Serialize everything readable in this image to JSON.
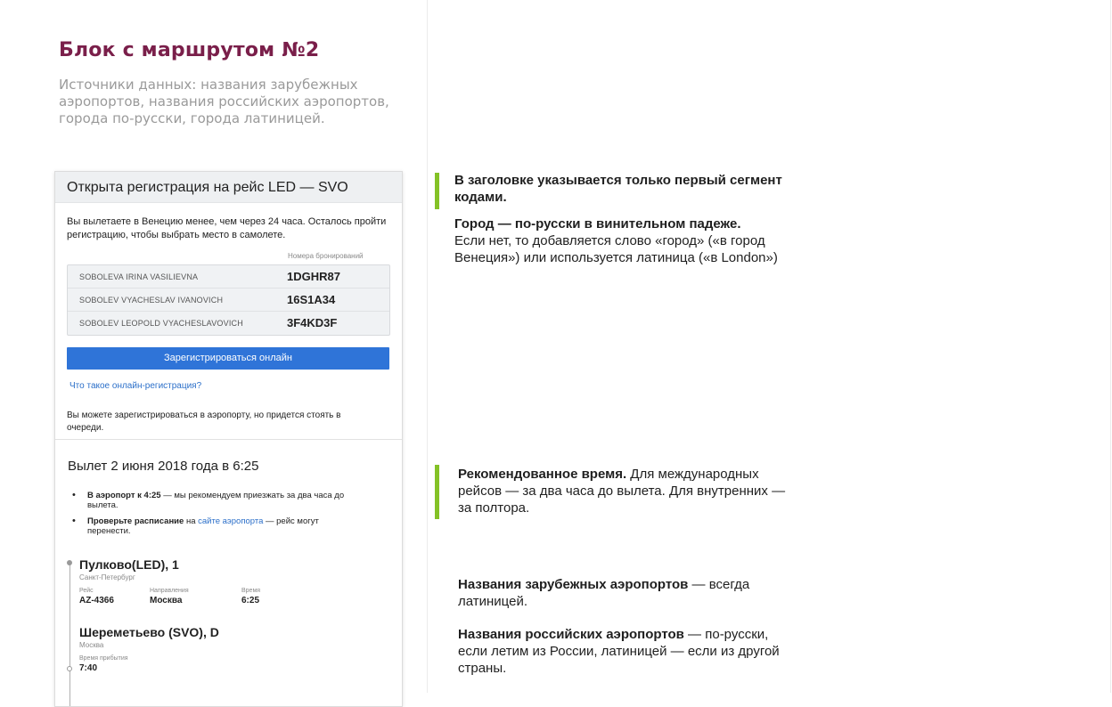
{
  "heading": {
    "title": "Блок с маршрутом №2",
    "subtitle": "Источники данных: названия зарубежных аэропортов, названия российских аэропортов, города по-русски, города латиницей."
  },
  "card": {
    "header": "Открыта регистрация на рейс LED — SVO",
    "intro": "Вы вылетаете в Венецию менее, чем через 24 часа. Осталось пройти регистрацию, чтобы выбрать место в самолете.",
    "pnr_caption": "Номера бронирований",
    "passengers": [
      {
        "name": "SOBOLEVA IRINA VASILIEVNA",
        "code": "1DGHR87"
      },
      {
        "name": "SOBOLEV VYACHESLAV IVANOVICH",
        "code": "16S1A34"
      },
      {
        "name": "SOBOLEV LEOPOLD VYACHESLAVOVICH",
        "code": "3F4KD3F"
      }
    ],
    "button": "Зарегистрироваться онлайн",
    "link": "Что такое онлайн-регистрация?",
    "note": "Вы можете зарегистрироваться в аэропорту, но придется стоять в очереди.",
    "departure": "Вылет 2 июня 2018 года в 6:25",
    "bullet1_bold": "В аэропорт к 4:25",
    "bullet1_rest": " — мы рекомендуем приезжать за два часа до вылета.",
    "bullet2_bold": "Проверьте расписание",
    "bullet2_mid": " на ",
    "bullet2_link": "сайте аэропорта",
    "bullet2_rest": " — рейс могут перенести.",
    "origin": {
      "airport": "Пулково(LED), 1",
      "city": "Санкт-Петербург"
    },
    "flight": {
      "flight_label": "Рейс",
      "flight_value": "AZ-4366",
      "dir_label": "Направления",
      "dir_value": "Москва",
      "time_label": "Время",
      "time_value": "6:25"
    },
    "destination": {
      "airport": "Шереметьево (SVO), D",
      "city": "Москва",
      "arrival_label": "Время прибытия",
      "arrival_value": "7:40"
    }
  },
  "annotations": {
    "a1_bold": "В заголовке указывается только первый сегмент кодами.",
    "a2_bold": "Город — по-русски в винительном падеже.",
    "a2_rest": "Если нет, то добавляется слово «город» («в город Венеция») или используется латиница («в London»)",
    "a3_bold": "Рекомендованное время.",
    "a3_rest": " Для международных рейсов — за два часа до вылета. Для внутренних — за полтора.",
    "a4_bold": "Названия зарубежных аэропортов",
    "a4_rest": " — всегда латиницей.",
    "a5_bold": "Названия российских аэропортов",
    "a5_rest": " — по-русски, если летим из России, латиницей — если из другой страны."
  },
  "colors": {
    "title": "#7a1f4a",
    "accent_bar": "#84c226",
    "button": "#2f74d8",
    "link": "#2b6fc9"
  }
}
